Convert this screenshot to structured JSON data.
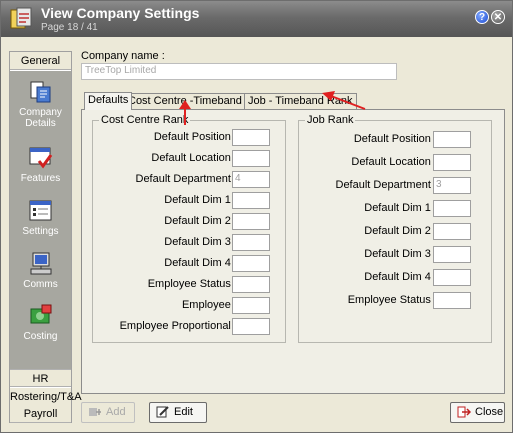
{
  "window": {
    "title": "View Company Settings",
    "subtitle": "Page 18 / 41",
    "help_label": "?",
    "close_label": "✕"
  },
  "nav": {
    "general_label": "General",
    "items": [
      {
        "label": "Company Details",
        "icon": "company-details-icon"
      },
      {
        "label": "Features",
        "icon": "features-icon"
      },
      {
        "label": "Settings",
        "icon": "settings-icon"
      },
      {
        "label": "Comms",
        "icon": "comms-icon"
      },
      {
        "label": "Costing",
        "icon": "costing-icon"
      }
    ],
    "sections": [
      "HR",
      "Rostering/T&A",
      "Payroll"
    ]
  },
  "company": {
    "label": "Company name :",
    "value": "TreeTop Limited"
  },
  "tabs": [
    "Defaults",
    "Cost Centre -Timeband Rank",
    "Job - Timeband Rank"
  ],
  "cost_centre_rank": {
    "title": "Cost Centre Rank",
    "fields": [
      {
        "label": "Default Position :",
        "value": ""
      },
      {
        "label": "Default Location :",
        "value": ""
      },
      {
        "label": "Default Department :",
        "value": "4"
      },
      {
        "label": "Default Dim 1 :",
        "value": ""
      },
      {
        "label": "Default Dim 2 :",
        "value": ""
      },
      {
        "label": "Default Dim 3 :",
        "value": ""
      },
      {
        "label": "Default Dim 4 :",
        "value": ""
      },
      {
        "label": "Employee Status :",
        "value": ""
      },
      {
        "label": "Employee :",
        "value": ""
      },
      {
        "label": "Employee Proportional :",
        "value": ""
      }
    ]
  },
  "job_rank": {
    "title": "Job Rank",
    "fields": [
      {
        "label": "Default Position :",
        "value": ""
      },
      {
        "label": "Default Location :",
        "value": ""
      },
      {
        "label": "Default Department :",
        "value": "3"
      },
      {
        "label": "Default Dim 1 :",
        "value": ""
      },
      {
        "label": "Default Dim 2 :",
        "value": ""
      },
      {
        "label": "Default Dim 3 :",
        "value": ""
      },
      {
        "label": "Default Dim 4 :",
        "value": ""
      },
      {
        "label": "Employee Status :",
        "value": ""
      }
    ]
  },
  "buttons": {
    "add": "Add",
    "edit": "Edit",
    "close": "Close"
  },
  "colors": {
    "title_bar": "#6a6a6a",
    "nav_panel": "#a7a7a0",
    "annotation_arrow": "#e02020"
  }
}
